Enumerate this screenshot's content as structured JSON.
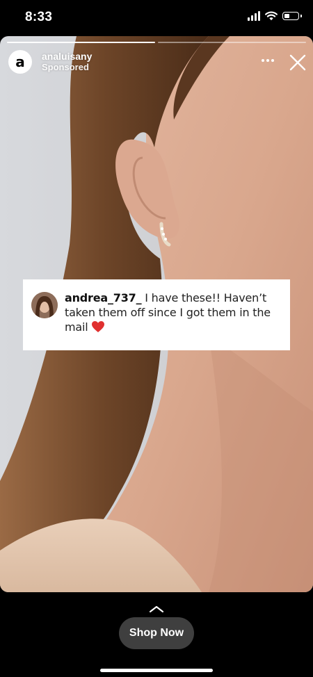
{
  "status_bar": {
    "time": "8:33",
    "signal_icon": "cellular-signal-icon",
    "wifi_icon": "wifi-icon",
    "battery_icon": "battery-icon"
  },
  "story": {
    "progress": [
      1,
      0
    ],
    "account": {
      "avatar_letter": "a",
      "name": "analuisany",
      "sponsored_label": "Sponsored"
    },
    "more_icon": "more-options-icon",
    "close_icon": "close-icon",
    "media_description_icon": "story-photo",
    "comment": {
      "username": "andrea_737_",
      "text": " I have these!! Haven’t taken them off since I got them in the mail ",
      "emoji_icon": "red-heart-icon"
    }
  },
  "cta": {
    "chevron_icon": "chevron-up-icon",
    "label": "Shop Now"
  },
  "colors": {
    "background": "#000000",
    "cta_button": "#3f3f3f",
    "comment_card": "#ffffff",
    "heart": "#e0302f"
  }
}
